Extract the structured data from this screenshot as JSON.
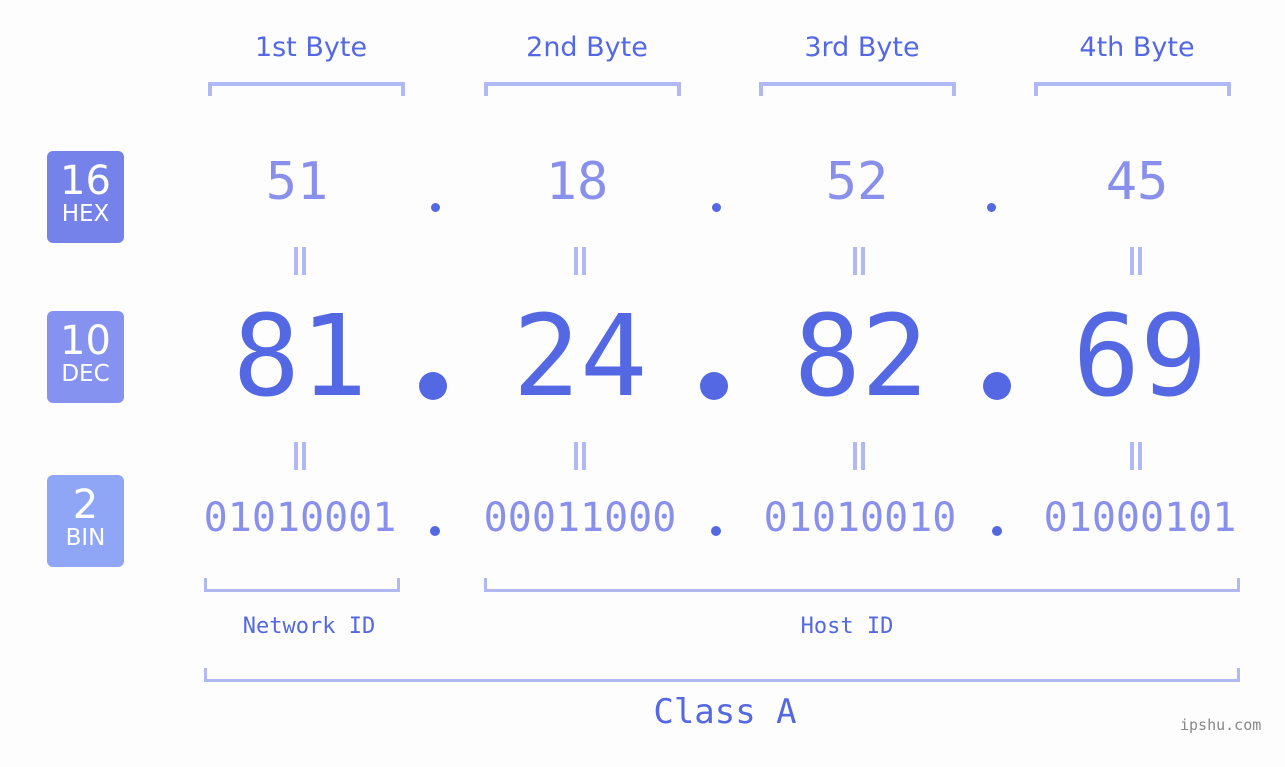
{
  "byte_headers": [
    "1st Byte",
    "2nd Byte",
    "3rd Byte",
    "4th Byte"
  ],
  "badges": {
    "hex": {
      "number": "16",
      "label": "HEX",
      "color": "#7482ea"
    },
    "dec": {
      "number": "10",
      "label": "DEC",
      "color": "#8692f0"
    },
    "bin": {
      "number": "2",
      "label": "BIN",
      "color": "#8fa6f7"
    }
  },
  "hex_values": [
    "51",
    "18",
    "52",
    "45"
  ],
  "dec_values": [
    "81",
    "24",
    "82",
    "69"
  ],
  "bin_values": [
    "01010001",
    "00011000",
    "01010010",
    "01000101"
  ],
  "separator": ".",
  "network_id_label": "Network ID",
  "host_id_label": "Host ID",
  "class_label": "Class A",
  "watermark": "ipshu.com",
  "colors": {
    "primary": "#5468e4",
    "light": "#8890ec",
    "bracket": "#b1b9f5"
  }
}
